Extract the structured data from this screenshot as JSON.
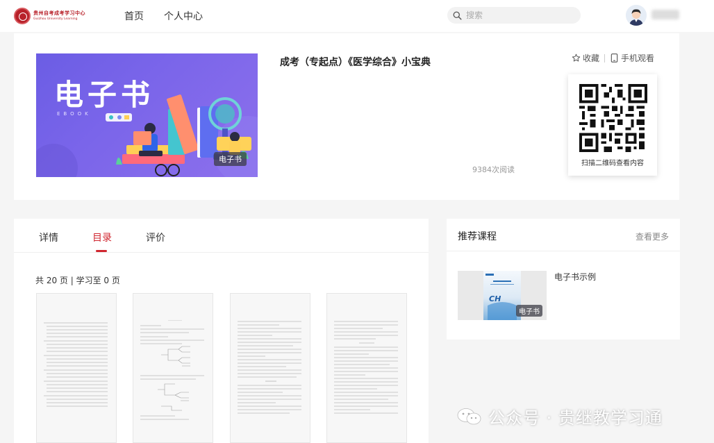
{
  "header": {
    "logo_cn": "贵州自考成考学习中心",
    "logo_en": "Guizhou University Learning",
    "nav": [
      "首页",
      "个人中心"
    ],
    "search_placeholder": "搜索"
  },
  "product": {
    "cover_title": "电子书",
    "cover_subtitle": "EBOOK",
    "cover_badge": "电子书",
    "title": "成考（专起点）《医学综合》小宝典",
    "favorite_label": "收藏",
    "mobile_label": "手机观看",
    "reads": "9384次阅读",
    "qr_caption": "扫描二维码查看内容"
  },
  "tabs": [
    {
      "label": "详情",
      "active": false
    },
    {
      "label": "目录",
      "active": true
    },
    {
      "label": "评价",
      "active": false
    }
  ],
  "page_info": "共 20 页 | 学习至 0 页",
  "thumbnails": [
    "page-1",
    "page-2",
    "page-3",
    "page-4"
  ],
  "recommend": {
    "title": "推荐课程",
    "more": "查看更多",
    "items": [
      {
        "name": "电子书示例",
        "badge": "电子书"
      }
    ]
  },
  "watermark": "公众号 · 贵继教学习通",
  "colors": {
    "accent": "#d0262f",
    "brand": "#b8212a",
    "cover": "#7a65ea"
  }
}
